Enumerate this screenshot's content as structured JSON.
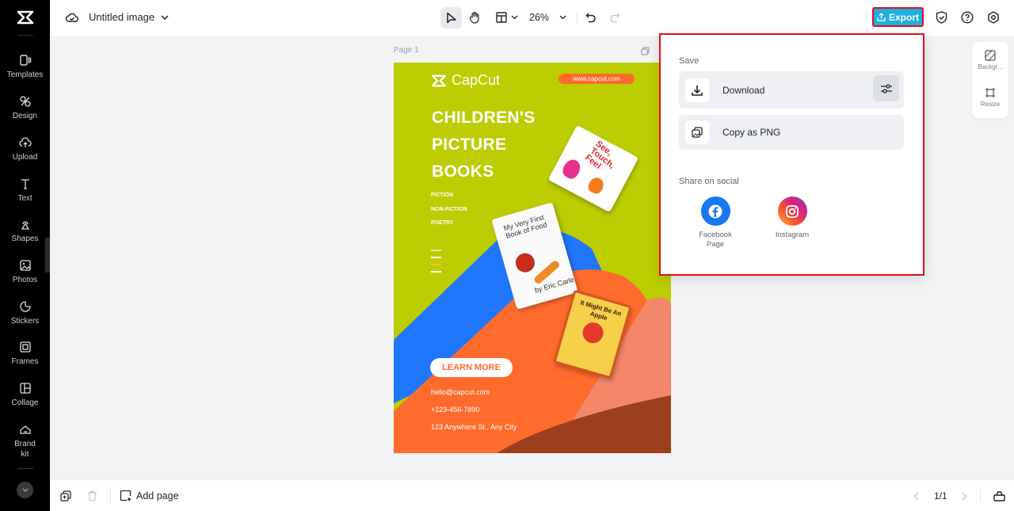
{
  "app": {
    "name": "CapCut"
  },
  "sidebar": {
    "items": [
      {
        "label": "Templates",
        "icon": "templates-icon"
      },
      {
        "label": "Design",
        "icon": "design-icon"
      },
      {
        "label": "Upload",
        "icon": "upload-icon"
      },
      {
        "label": "Text",
        "icon": "text-icon"
      },
      {
        "label": "Shapes",
        "icon": "shapes-icon"
      },
      {
        "label": "Photos",
        "icon": "photos-icon"
      },
      {
        "label": "Stickers",
        "icon": "stickers-icon"
      },
      {
        "label": "Frames",
        "icon": "frames-icon"
      },
      {
        "label": "Collage",
        "icon": "collage-icon"
      },
      {
        "label": "Brand kit",
        "icon": "brand-kit-icon"
      }
    ]
  },
  "topbar": {
    "title": "Untitled image",
    "zoom": "26%",
    "export_label": "Export"
  },
  "canvas": {
    "page_label": "Page 1"
  },
  "poster": {
    "brand": "CapCut",
    "url": "www.capcut.com",
    "headline": [
      "CHILDREN'S",
      "PICTURE",
      "BOOKS"
    ],
    "categories": [
      "FICTION",
      "NON-FICTION",
      "POETRY"
    ],
    "cta": "LEARN MORE",
    "email": "hello@capcut.com",
    "phone": "+123-456-7890",
    "address": "123 Anywhere St., Any City",
    "books": [
      {
        "title": "See, Touch, Feel"
      },
      {
        "title": "My Very First Book of Food",
        "author": "by Eric Carle"
      },
      {
        "title": "It Might Be An Apple"
      }
    ],
    "colors": {
      "lime": "#bccd02",
      "blue": "#2176ff",
      "orange": "#ff6b2c",
      "salmon": "#f4876a",
      "brown": "#9c3f1d"
    }
  },
  "right_panel": {
    "items": [
      {
        "label": "Backgr...",
        "icon": "background-icon"
      },
      {
        "label": "Resize",
        "icon": "resize-icon"
      }
    ]
  },
  "export_panel": {
    "save_label": "Save",
    "download_label": "Download",
    "copy_label": "Copy as PNG",
    "share_label": "Share on social",
    "social": [
      {
        "label": "Facebook Page",
        "icon": "facebook-icon",
        "color": "#1877f2"
      },
      {
        "label": "Instagram",
        "icon": "instagram-icon"
      }
    ]
  },
  "bottombar": {
    "add_page_label": "Add page",
    "page_indicator": "1/1"
  }
}
